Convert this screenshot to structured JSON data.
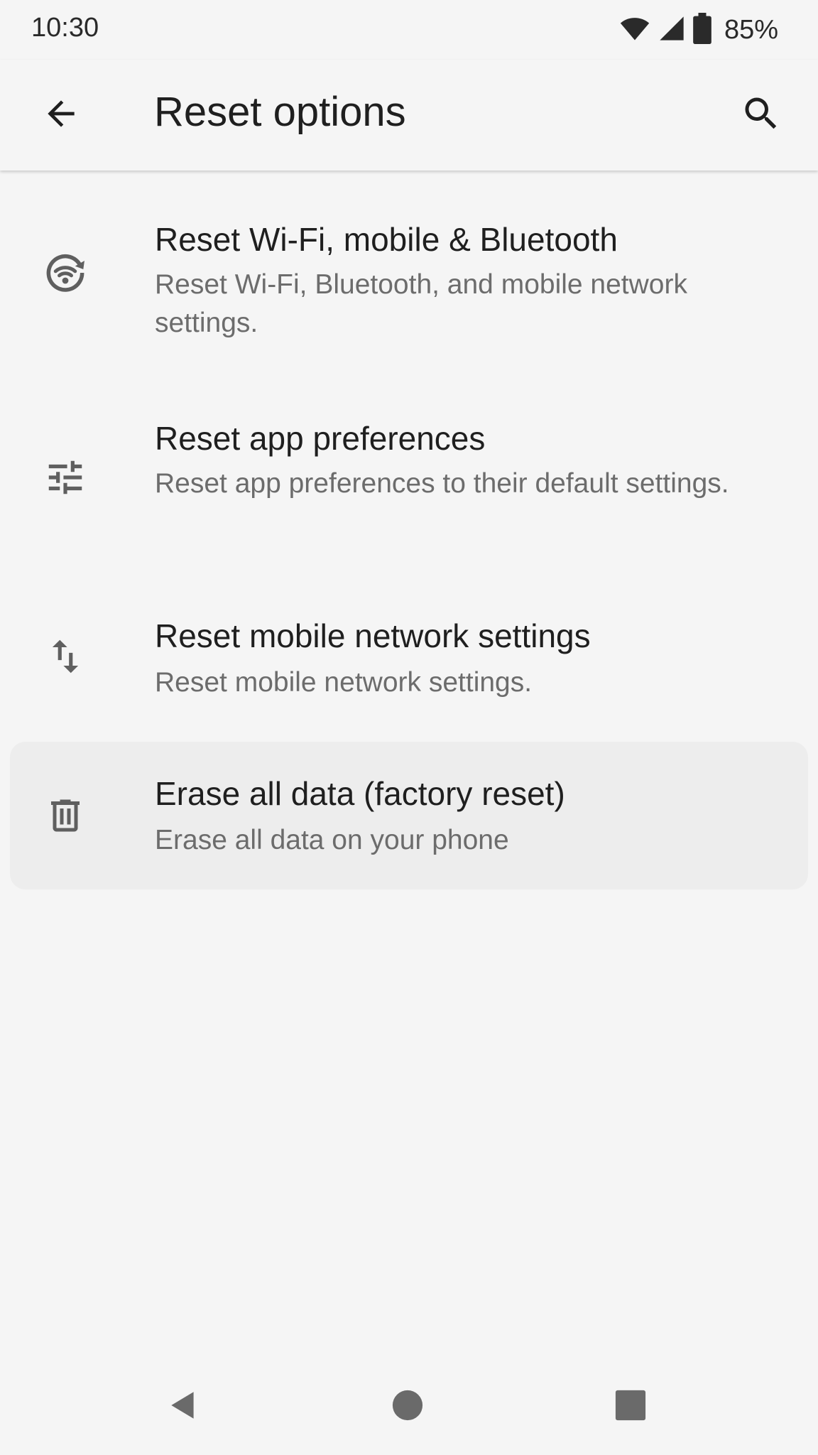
{
  "status_bar": {
    "time": "10:30",
    "battery_percent": "85%",
    "icons": [
      "wifi-icon",
      "cell-signal-icon",
      "battery-icon"
    ]
  },
  "app_bar": {
    "title": "Reset options",
    "back_icon": "arrow-back-icon",
    "search_icon": "search-icon"
  },
  "items": [
    {
      "icon": "reset-wifi-icon",
      "title": "Reset Wi-Fi, mobile & Bluetooth",
      "summary": "Reset Wi-Fi, Bluetooth, and mobile network settings."
    },
    {
      "icon": "tune-sliders-icon",
      "title": "Reset app preferences",
      "summary": "Reset app preferences to their default settings."
    },
    {
      "icon": "swap-vertical-icon",
      "title": "Reset mobile network settings",
      "summary": "Reset mobile network settings."
    },
    {
      "icon": "trash-icon",
      "title": "Erase all data (factory reset)",
      "summary": "Erase all data on your phone"
    }
  ],
  "nav_bar": {
    "buttons": [
      "back-triangle-icon",
      "home-circle-icon",
      "recents-square-icon"
    ]
  },
  "colors": {
    "background": "#f5f5f5",
    "title_text": "#1f1f1f",
    "summary_text": "#6c6c6c",
    "icon": "#5f5f5f",
    "highlight": "#ededed"
  }
}
